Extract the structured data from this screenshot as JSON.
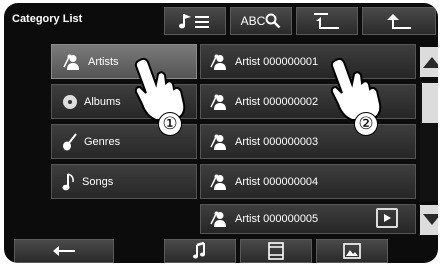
{
  "header": {
    "title": "Category List",
    "abc_label": "ABC"
  },
  "categories": [
    {
      "label": "Artists",
      "icon": "artist-icon",
      "selected": true
    },
    {
      "label": "Albums",
      "icon": "album-disc-icon",
      "selected": false
    },
    {
      "label": "Genres",
      "icon": "guitar-icon",
      "selected": false
    },
    {
      "label": "Songs",
      "icon": "music-note-icon",
      "selected": false
    }
  ],
  "items": [
    {
      "label": "Artist 000000001"
    },
    {
      "label": "Artist 000000002"
    },
    {
      "label": "Artist 000000003"
    },
    {
      "label": "Artist 000000004"
    },
    {
      "label": "Artist 000000005"
    }
  ],
  "callouts": [
    "①",
    "②"
  ],
  "colors": {
    "background": "#0c0c0c",
    "selected": "#6a6a6a",
    "scrollbar": "#dcdcdc"
  }
}
